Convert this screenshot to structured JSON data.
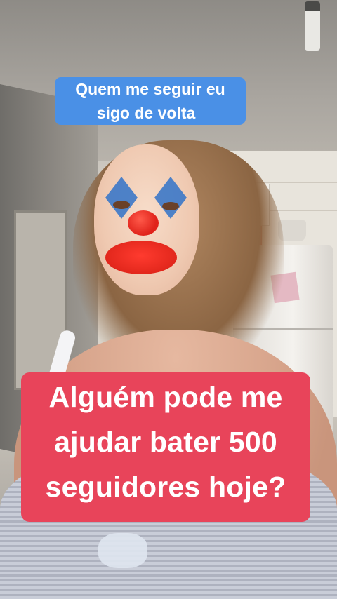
{
  "overlay": {
    "top_sticker_lines": [
      "Quem me seguir eu",
      "sigo de volta"
    ],
    "caption_lines": [
      "Alguém pode me",
      "ajudar bater 500",
      "seguidores hoje?"
    ]
  },
  "colors": {
    "top_sticker_bg": "#4a90e6",
    "caption_bg": "#e8445a",
    "text": "#ffffff"
  }
}
